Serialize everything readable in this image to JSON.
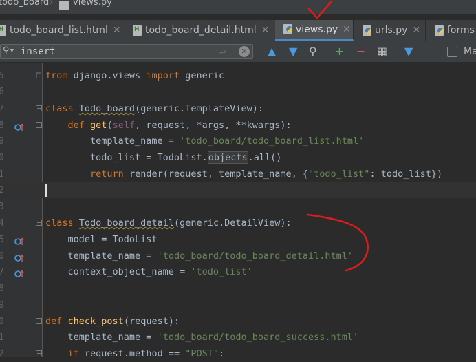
{
  "breadcrumb": {
    "project": "todo_board",
    "file": "views.py"
  },
  "tabs": [
    {
      "label": "todo_board_list.html",
      "type": "html",
      "active": false
    },
    {
      "label": "todo_board_detail.html",
      "type": "html",
      "active": false
    },
    {
      "label": "views.py",
      "type": "py",
      "active": true
    },
    {
      "label": "urls.py",
      "type": "py",
      "active": false
    },
    {
      "label": "forms",
      "type": "py",
      "active": false
    }
  ],
  "findbar": {
    "query": "insert",
    "match_case_label": "Ma"
  },
  "editor": {
    "lines": [
      {
        "num": "5",
        "text": "from django.views import generic"
      },
      {
        "num": "6",
        "text": ""
      },
      {
        "num": "7",
        "text": "class Todo_board(generic.TemplateView):"
      },
      {
        "num": "8",
        "text": "    def get(self, request, *args, **kwargs):"
      },
      {
        "num": "9",
        "text": "        template_name = 'todo_board/todo_board_list.html'"
      },
      {
        "num": "0",
        "text": "        todo_list = TodoList.objects.all()"
      },
      {
        "num": "1",
        "text": "        return render(request, template_name, {\"todo_list\": todo_list})"
      },
      {
        "num": "2",
        "text": ""
      },
      {
        "num": "3",
        "text": ""
      },
      {
        "num": "4",
        "text": "class Todo_board_detail(generic.DetailView):"
      },
      {
        "num": "5",
        "text": "    model = TodoList"
      },
      {
        "num": "6",
        "text": "    template_name = 'todo_board/todo_board_detail.html'"
      },
      {
        "num": "7",
        "text": "    context_object_name = 'todo_list'"
      },
      {
        "num": "8",
        "text": ""
      },
      {
        "num": "9",
        "text": ""
      },
      {
        "num": "0",
        "text": "def check_post(request):"
      },
      {
        "num": "1",
        "text": "    template_name = 'todo_board/todo_board_success.html'"
      },
      {
        "num": "2",
        "text": "    if request.method == \"POST\":"
      }
    ]
  },
  "colors": {
    "accent": "#4a88c7",
    "annotation": "#e01b1b"
  }
}
